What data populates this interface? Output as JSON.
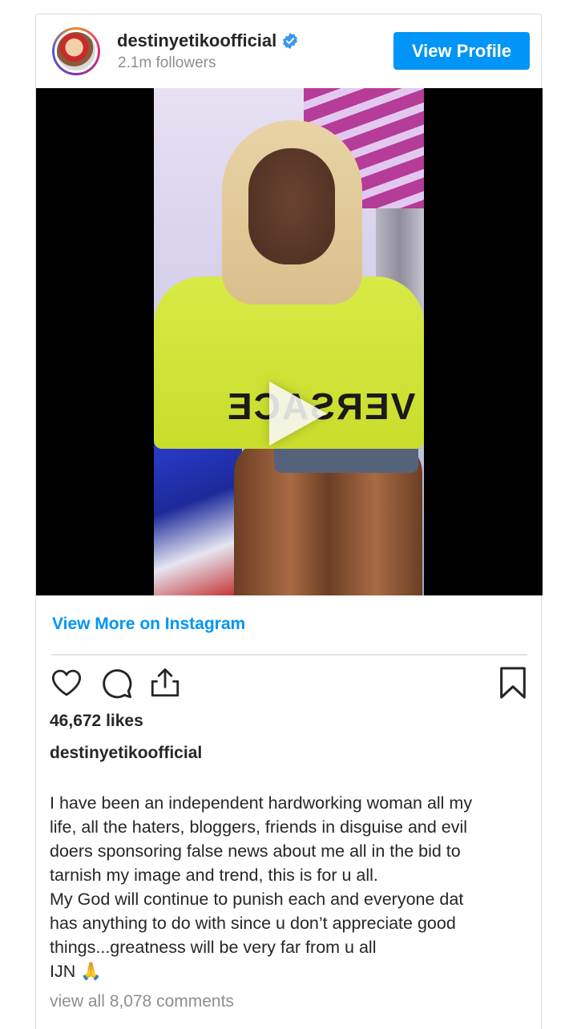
{
  "header": {
    "username": "destinyetikoofficial",
    "followers": "2.1m followers",
    "view_profile_label": "View Profile"
  },
  "media": {
    "type": "video",
    "overlay_text": "VERSACE"
  },
  "links": {
    "view_more": "View More on Instagram"
  },
  "actions": {
    "icons": [
      "heart-icon",
      "comment-icon",
      "share-icon",
      "bookmark-icon"
    ]
  },
  "post": {
    "likes": "46,672 likes",
    "caption_user": "destinyetikoofficial",
    "caption": "I have been an independent hardworking woman all my\nlife, all the haters, bloggers, friends in disguise and evil\ndoers sponsoring false news about me all in the bid to\ntarnish my image and trend, this is for u all.\nMy God will continue to punish each and everyone dat\nhas anything to do with since u don’t appreciate good\nthings...greatness will be very far from u all\nIJN 🙏",
    "comments_link": "view all 8,078 comments"
  },
  "colors": {
    "accent": "#0095f6",
    "text": "#262626",
    "muted": "#8e8e8e",
    "border": "#dbdbdb"
  }
}
